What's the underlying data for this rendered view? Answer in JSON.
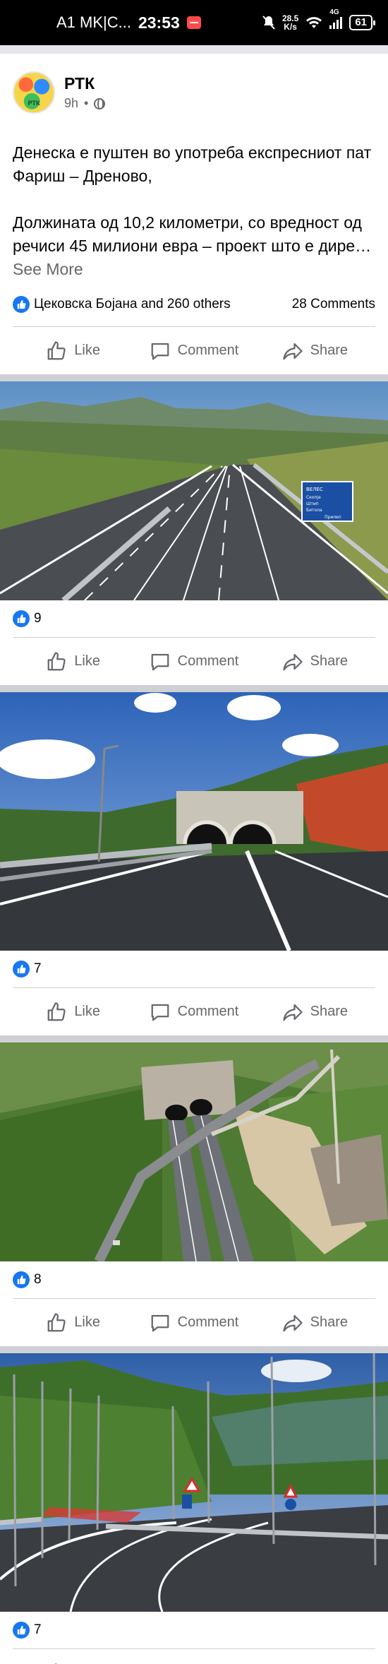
{
  "status_bar": {
    "carrier": "A1 MK|C...",
    "time": "23:53",
    "speed_value": "28.5",
    "speed_unit": "K/s",
    "network": "4G",
    "battery": "61"
  },
  "post": {
    "page_name": "РТК",
    "time_ago": "9h",
    "dot": "•",
    "text_line1": "Денеска е пуштен во употреба експресниот пат Фариш – Дреново,",
    "text_line2": "Должината од 10,2 километри, со вредност од речиси 45 милиони евра – проект што е дире…",
    "see_more": "See More",
    "reactions_text": "Цековска Бојана and 260 others",
    "comments_text": "28 Comments"
  },
  "actions": {
    "like": "Like",
    "comment": "Comment",
    "share": "Share"
  },
  "photos": [
    {
      "likes": "9"
    },
    {
      "likes": "7"
    },
    {
      "likes": "8"
    },
    {
      "likes": "7"
    }
  ],
  "road_sign": {
    "line1": "ВЕЛЕС",
    "line2": "Скопје",
    "line3": "Штип",
    "line4": "Битола",
    "line5": "Прилеп"
  },
  "colors": {
    "facebook_blue": "#1877f2",
    "secondary_text": "#65676b",
    "separator": "#ced0d4"
  }
}
